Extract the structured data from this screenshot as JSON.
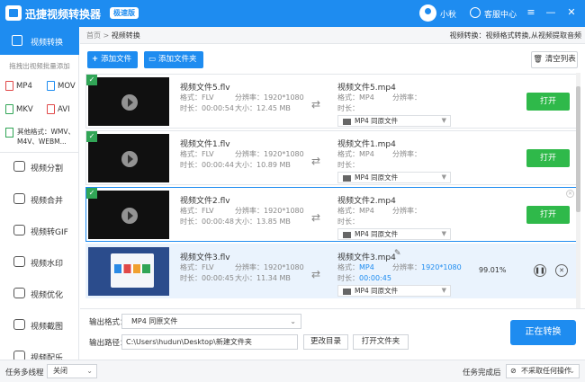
{
  "app": {
    "title": "迅捷视频转换器",
    "badge": "极速版",
    "user": "小秋",
    "help": "客服中心"
  },
  "window_buttons": [
    "≡",
    "—",
    "✕"
  ],
  "sidebar": {
    "active": "视频转换",
    "hint": "拖拽出视频批量添加",
    "formats": [
      "MP4",
      "MOV",
      "MKV",
      "AVI"
    ],
    "other_formats": "其他格式：WMV、M4V、WEBM...",
    "items": [
      "视频分割",
      "视频合并",
      "视频转GIF",
      "视频水印",
      "视频优化",
      "视频截图",
      "视频配乐"
    ]
  },
  "breadcrumb": {
    "home": "首页",
    "sep": ">",
    "current": "视频转换"
  },
  "tip": "视频转换：视频格式转换,从视频提取音频",
  "toolbar": {
    "add_file": "添加文件",
    "add_folder": "添加文件夹",
    "clear": "清空列表"
  },
  "labels": {
    "format": "格式：",
    "resolution": "分辨率：",
    "duration": "时长：",
    "size": "大小：",
    "open": "打开"
  },
  "files": [
    {
      "name": "视频文件5.flv",
      "format": "FLV",
      "resolution": "1920*1080",
      "duration": "00:00:54",
      "size": "12.45 MB",
      "out_name": "视频文件5.mp4",
      "out_format": "MP4",
      "out_resolution": "分辨率：",
      "out_duration": "时长：",
      "out_select": "MP4  同原文件"
    },
    {
      "name": "视频文件1.flv",
      "format": "FLV",
      "resolution": "1920*1080",
      "duration": "00:00:44",
      "size": "10.89 MB",
      "out_name": "视频文件1.mp4",
      "out_format": "MP4",
      "out_resolution": "分辨率：",
      "out_duration": "时长：",
      "out_select": "MP4  同原文件"
    },
    {
      "name": "视频文件2.flv",
      "format": "FLV",
      "resolution": "1920*1080",
      "duration": "00:00:48",
      "size": "13.85 MB",
      "out_name": "视频文件2.mp4",
      "out_format": "MP4",
      "out_resolution": "分辨率：",
      "out_duration": "时长：",
      "out_select": "MP4  同原文件"
    },
    {
      "name": "视频文件3.flv",
      "format": "FLV",
      "resolution": "1920*1080",
      "duration": "00:00:45",
      "size": "11.34 MB",
      "out_name": "视频文件3.mp4",
      "out_format": "MP4",
      "out_resolution": "1920*1080",
      "out_duration": "00:00:45",
      "out_select": "MP4  同原文件",
      "progress": "99.01%"
    }
  ],
  "bottom": {
    "format_label": "输出格式：",
    "format_value": "MP4  同原文件",
    "path_label": "输出路径：",
    "path_value": "C:\\Users\\hudun\\Desktop\\新建文件夹",
    "change_dir": "更改目录",
    "open_folder": "打开文件夹",
    "convert": "正在转换"
  },
  "status": {
    "multithread_label": "任务多线程",
    "multithread_value": "关闭",
    "after_label": "任务完成后",
    "after_value": "不采取任何操作"
  },
  "colors": {
    "primary": "#1e8cf0",
    "green": "#2fb94a",
    "check": "#31a556"
  }
}
